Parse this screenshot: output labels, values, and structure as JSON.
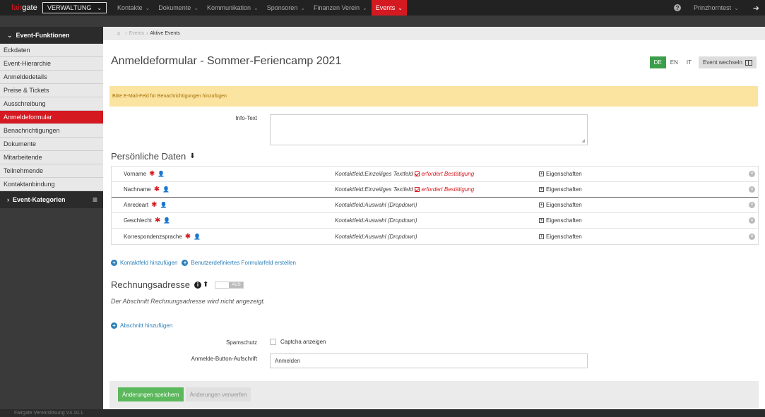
{
  "topbar": {
    "brand_accent": "fair",
    "brand_rest": "gate",
    "mode_label": "VERWALTUNG",
    "nav": [
      {
        "label": "Kontakte"
      },
      {
        "label": "Dokumente"
      },
      {
        "label": "Kommunikation"
      },
      {
        "label": "Sponsoren"
      },
      {
        "label": "Finanzen Verein"
      },
      {
        "label": "Events"
      }
    ],
    "user": "Prinzhorntest"
  },
  "sidebar": {
    "section_title": "Event-Funktionen",
    "items": [
      {
        "label": "Eckdaten"
      },
      {
        "label": "Event-Hierarchie"
      },
      {
        "label": "Anmeldedetails"
      },
      {
        "label": "Preise & Tickets"
      },
      {
        "label": "Ausschreibung"
      },
      {
        "label": "Anmeldeformular"
      },
      {
        "label": "Benachrichtigungen"
      },
      {
        "label": "Dokumente"
      },
      {
        "label": "Mitarbeitende"
      },
      {
        "label": "Teilnehmende"
      },
      {
        "label": "Kontaktanbindung"
      }
    ],
    "categories_title": "Event-Kategorien"
  },
  "breadcrumb": {
    "link": "Events",
    "current": "Aktive Events"
  },
  "page": {
    "title": "Anmeldeformular - Sommer-Feriencamp 2021",
    "languages": [
      "DE",
      "EN",
      "IT"
    ],
    "event_switch": "Event wechseln"
  },
  "alert": {
    "text": "Bitte E-Mail-Feld für Benachrichtigungen hinzufügen"
  },
  "info": {
    "label": "Info-Text",
    "value": ""
  },
  "personal": {
    "title": "Persönliche Daten",
    "fields": [
      {
        "name": "Vorname",
        "type": "Kontaktfeld:Einzeiliges Textfeld",
        "confirm": "erfordert Bestätigung",
        "props": "Eigenschaften"
      },
      {
        "name": "Nachname",
        "type": "Kontaktfeld:Einzeiliges Textfeld",
        "confirm": "erfordert Bestätigung",
        "props": "Eigenschaften"
      },
      {
        "name": "Anredeart",
        "type": "Kontaktfeld:Auswahl (Dropdown)",
        "confirm": "",
        "props": "Eigenschaften"
      },
      {
        "name": "Geschlecht",
        "type": "Kontaktfeld:Auswahl (Dropdown)",
        "confirm": "",
        "props": "Eigenschaften"
      },
      {
        "name": "Korrespondenzsprache",
        "type": "Kontaktfeld:Auswahl (Dropdown)",
        "confirm": "",
        "props": "Eigenschaften"
      }
    ],
    "add_contact_field": "Kontaktfeld hinzufügen",
    "add_custom_field": "Benutzerdefiniertes Formularfeld erstellen"
  },
  "billing": {
    "title": "Rechnungsadresse",
    "toggle_label": "AUS",
    "note": "Der Abschnitt Rechnungsadresse wird nicht angezeigt."
  },
  "add_section": "Abschnitt hinzufügen",
  "spam": {
    "label": "Spamschutz",
    "checkbox_label": "Captcha anzeigen"
  },
  "button_caption": {
    "label": "Anmelde-Button-Aufschrift",
    "value": "Anmelden"
  },
  "actions": {
    "save": "Änderungen speichern",
    "discard": "Änderungen verwerfen"
  },
  "status": {
    "text": "Fairgate Vereinslösung V4.10.1"
  },
  "colors": {
    "accent": "#d51920",
    "success": "#5cb85c",
    "link": "#2b7fb8",
    "alert_bg": "#fbe3a0"
  }
}
